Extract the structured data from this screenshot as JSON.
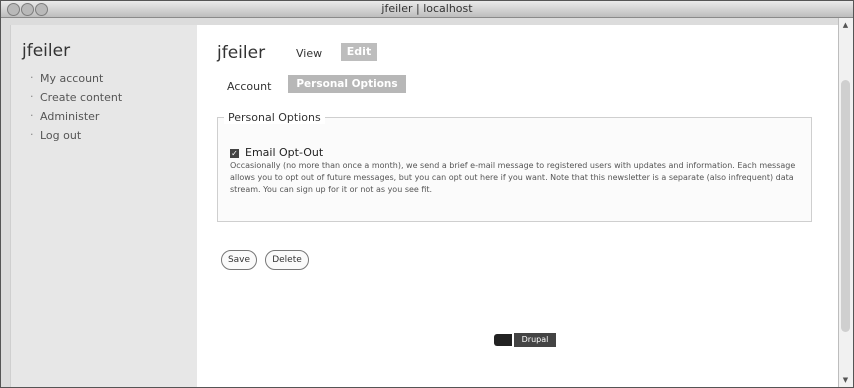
{
  "window": {
    "title": "jfeiler | localhost"
  },
  "sidebar": {
    "title": "jfeiler",
    "items": [
      {
        "label": "My account"
      },
      {
        "label": "Create content"
      },
      {
        "label": "Administer"
      },
      {
        "label": "Log out"
      }
    ]
  },
  "main": {
    "title": "jfeiler",
    "tabs": {
      "view": "View",
      "edit": "Edit"
    },
    "subtabs": {
      "account": "Account",
      "personal": "Personal Options"
    },
    "fieldset": {
      "legend": "Personal Options",
      "checkbox_label": "Email Opt-Out",
      "checkbox_checked": true,
      "description": "Occasionally (no more than once a month), we send a brief e-mail message to registered users with updates and information. Each message allows you to opt out of future messages, but you can opt out here if you want. Note that this newsletter is a separate (also infrequent) data stream. You can sign up for it or not as you see fit."
    },
    "buttons": {
      "save": "Save",
      "delete": "Delete"
    },
    "badge": "Drupal"
  }
}
